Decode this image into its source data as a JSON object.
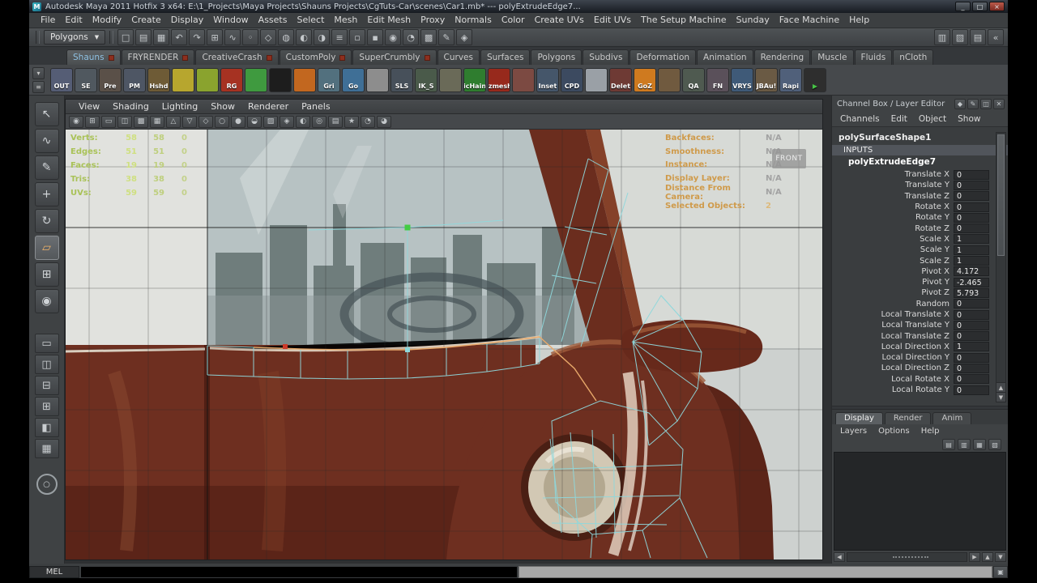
{
  "colors": {
    "accent_active_tab_text": "#8fc1e3",
    "hud_label_green": "#a9c257",
    "hud_value_green": "#cfe080",
    "hud_label_orange": "#cf9a4a",
    "hud_value_gray": "#a2a2a2",
    "car_body": "#6e2f20",
    "wireframe_cyan": "#8fd8dc",
    "selected_edge_orange": "#e8a96a",
    "vertex_green": "#44cc44",
    "vertex_red": "#cc3a2a"
  },
  "title_bar": {
    "title": "Autodesk Maya 2011 Hotfix 3 x64: E:\\1_Projects\\Maya Projects\\Shauns Projects\\CgTuts-Car\\scenes\\Car1.mb*   ---   polyExtrudeEdge7...",
    "logo": "M",
    "minimize": "_",
    "maximize": "□",
    "close": "×"
  },
  "menu_bar": {
    "items": [
      "File",
      "Edit",
      "Modify",
      "Create",
      "Display",
      "Window",
      "Assets",
      "Select",
      "Mesh",
      "Edit Mesh",
      "Proxy",
      "Normals",
      "Color",
      "Create UVs",
      "Edit UVs",
      "The Setup Machine",
      "Sunday",
      "Face Machine",
      "Help"
    ]
  },
  "status_line": {
    "menuset": "Polygons",
    "arrow": "▼",
    "icons": [
      {
        "name": "new-scene-icon",
        "glyph": "□"
      },
      {
        "name": "open-scene-icon",
        "glyph": "▤"
      },
      {
        "name": "save-scene-icon",
        "glyph": "▦"
      },
      {
        "name": "undo-icon",
        "glyph": "↶"
      },
      {
        "name": "redo-icon",
        "glyph": "↷"
      },
      {
        "name": "snap-to-grid-icon",
        "glyph": "⊞"
      },
      {
        "name": "snap-to-curve-icon",
        "glyph": "∿"
      },
      {
        "name": "snap-to-point-icon",
        "glyph": "◦"
      },
      {
        "name": "snap-to-plane-icon",
        "glyph": "◇"
      },
      {
        "name": "make-live-icon",
        "glyph": "◍"
      },
      {
        "name": "input-connections-icon",
        "glyph": "◐"
      },
      {
        "name": "output-connections-icon",
        "glyph": "◑"
      },
      {
        "name": "construction-history-icon",
        "glyph": "≡"
      },
      {
        "name": "select-by-object-icon",
        "glyph": "▫"
      },
      {
        "name": "select-by-component-icon",
        "glyph": "▪"
      },
      {
        "name": "render-current-frame-icon",
        "glyph": "◉"
      },
      {
        "name": "ipr-render-icon",
        "glyph": "◔"
      },
      {
        "name": "render-settings-icon",
        "glyph": "▩"
      },
      {
        "name": "paint-effects-icon",
        "glyph": "✎"
      },
      {
        "name": "hypershade-icon",
        "glyph": "◈"
      }
    ],
    "right_icons": [
      {
        "name": "attribute-editor-toggle-icon",
        "glyph": "▥"
      },
      {
        "name": "tool-settings-toggle-icon",
        "glyph": "▨"
      },
      {
        "name": "channel-box-toggle-icon",
        "glyph": "▤"
      },
      {
        "name": "collapse-statusline-icon",
        "glyph": "«"
      }
    ]
  },
  "shelf": {
    "selector_arrow": "▾",
    "selector_menu": "≡",
    "tabs": [
      {
        "label": "Shauns",
        "active": true,
        "marker": true
      },
      {
        "label": "FRYRENDER",
        "marker": true
      },
      {
        "label": "CreativeCrash",
        "marker": true
      },
      {
        "label": "CustomPoly",
        "marker": true
      },
      {
        "label": "SuperCrumbly",
        "marker": true
      },
      {
        "label": "Curves"
      },
      {
        "label": "Surfaces"
      },
      {
        "label": "Polygons"
      },
      {
        "label": "Subdivs"
      },
      {
        "label": "Deformation"
      },
      {
        "label": "Animation"
      },
      {
        "label": "Rendering"
      },
      {
        "label": "Muscle"
      },
      {
        "label": "Fluids"
      },
      {
        "label": "nCloth"
      }
    ],
    "items": [
      {
        "label": "OUT",
        "color": "#555d75"
      },
      {
        "label": "SE",
        "color": "#50585f"
      },
      {
        "label": "Pre",
        "color": "#5a5048"
      },
      {
        "label": "PM",
        "color": "#4e5664"
      },
      {
        "label": "Hshd",
        "color": "#6e5b36"
      },
      {
        "label": "",
        "color": "#b7a62e"
      },
      {
        "label": "",
        "color": "#8aa32e"
      },
      {
        "label": "RG",
        "color": "#a63222"
      },
      {
        "label": "",
        "color": "#3f9a3f"
      },
      {
        "label": "",
        "color": "#1d1d1d"
      },
      {
        "label": "",
        "color": "#c2671f"
      },
      {
        "label": "Gri",
        "color": "#52707e"
      },
      {
        "label": "Go",
        "color": "#3f6f96"
      },
      {
        "label": "",
        "color": "#8d8d8d"
      },
      {
        "label": "SLS",
        "color": "#47505a"
      },
      {
        "label": "IK_S",
        "color": "#4a5a4a"
      },
      {
        "label": "",
        "color": "#6a6a58"
      },
      {
        "label": "icHain",
        "color": "#2f7d2f"
      },
      {
        "label": "izmesh",
        "color": "#97291c"
      },
      {
        "label": "",
        "color": "#7c4a42"
      },
      {
        "label": "Inset",
        "color": "#45566a"
      },
      {
        "label": "CPD",
        "color": "#3c4a60"
      },
      {
        "label": "",
        "color": "#9aa0a6"
      },
      {
        "label": "Delet",
        "color": "#6e3a34"
      },
      {
        "label": "GoZ",
        "color": "#cf7a1f"
      },
      {
        "label": "",
        "color": "#705a3f"
      },
      {
        "label": "QA",
        "color": "#4f5a50"
      },
      {
        "label": "FN",
        "color": "#5a505a"
      },
      {
        "label": "VRYS",
        "color": "#3f5a78"
      },
      {
        "label": "JBAu!",
        "color": "#6a5a44"
      },
      {
        "label": "Rapi",
        "color": "#50607a"
      },
      {
        "label": "▶",
        "color": "#2e2e2e",
        "fg": "#47c247"
      }
    ]
  },
  "toolbox": {
    "tools": [
      {
        "name": "select-tool",
        "glyph": "↖"
      },
      {
        "name": "lasso-select-tool",
        "glyph": "∿"
      },
      {
        "name": "paint-select-tool",
        "glyph": "✎"
      },
      {
        "name": "move-tool",
        "glyph": "+"
      },
      {
        "name": "rotate-tool",
        "glyph": "↻"
      },
      {
        "name": "scale-tool",
        "glyph": "▱",
        "active": true
      },
      {
        "name": "universal-manipulator-tool",
        "glyph": "⊞"
      },
      {
        "name": "soft-mod-tool",
        "glyph": "◉"
      }
    ],
    "layouts": [
      {
        "name": "layout-single-pane",
        "glyph": "▭"
      },
      {
        "name": "layout-two-panes-side",
        "glyph": "◫"
      },
      {
        "name": "layout-two-panes-stacked",
        "glyph": "⊟"
      },
      {
        "name": "layout-four-panes",
        "glyph": "⊞"
      },
      {
        "name": "layout-outliner-persp",
        "glyph": "◧"
      },
      {
        "name": "layout-hypergraph-persp",
        "glyph": "▦"
      }
    ],
    "xview": "○"
  },
  "viewport": {
    "menus": [
      "View",
      "Shading",
      "Lighting",
      "Show",
      "Renderer",
      "Panels"
    ],
    "toolbar_icons": [
      {
        "name": "camera-select-icon",
        "glyph": "◉"
      },
      {
        "name": "grid-toggle-icon",
        "glyph": "⊞"
      },
      {
        "name": "film-gate-icon",
        "glyph": "▭"
      },
      {
        "name": "resolution-gate-icon",
        "glyph": "◫"
      },
      {
        "name": "gate-mask-icon",
        "glyph": "▩"
      },
      {
        "name": "field-chart-icon",
        "glyph": "▦"
      },
      {
        "name": "safe-action-icon",
        "glyph": "△"
      },
      {
        "name": "safe-title-icon",
        "glyph": "▽"
      },
      {
        "name": "frame-all-icon",
        "glyph": "◇"
      },
      {
        "name": "default-lighting-icon",
        "glyph": "○"
      },
      {
        "name": "all-lights-icon",
        "glyph": "●"
      },
      {
        "name": "shadows-icon",
        "glyph": "◒"
      },
      {
        "name": "textured-mode-icon",
        "glyph": "▨"
      },
      {
        "name": "wireframe-on-shaded-icon",
        "glyph": "◈"
      },
      {
        "name": "xray-icon",
        "glyph": "◐"
      },
      {
        "name": "isolate-select-icon",
        "glyph": "◎"
      },
      {
        "name": "image-plane-icon",
        "glyph": "▤"
      },
      {
        "name": "bookmark-icon",
        "glyph": "★"
      },
      {
        "name": "exposure-icon",
        "glyph": "◔"
      },
      {
        "name": "gamma-icon",
        "glyph": "◕"
      }
    ],
    "hud_left": {
      "rows": [
        {
          "label": "Verts:",
          "a": "58",
          "b": "58",
          "c": "0"
        },
        {
          "label": "Edges:",
          "a": "51",
          "b": "51",
          "c": "0"
        },
        {
          "label": "Faces:",
          "a": "19",
          "b": "19",
          "c": "0"
        },
        {
          "label": "Tris:",
          "a": "38",
          "b": "38",
          "c": "0"
        },
        {
          "label": "UVs:",
          "a": "59",
          "b": "59",
          "c": "0"
        }
      ]
    },
    "hud_right": {
      "rows": [
        {
          "label": "Backfaces:",
          "value": "N/A"
        },
        {
          "label": "Smoothness:",
          "value": "N/A"
        },
        {
          "label": "Instance:",
          "value": "N/A"
        },
        {
          "label": "Display Layer:",
          "value": "N/A"
        },
        {
          "label": "Distance From Camera:",
          "value": "N/A"
        },
        {
          "label": "Selected Objects:",
          "value": "2",
          "highlight": true
        }
      ]
    },
    "view_label": "FRONT"
  },
  "channel_box": {
    "header": "Channel Box / Layer Editor",
    "header_icons": [
      {
        "name": "pick-pin-icon",
        "glyph": "◆"
      },
      {
        "name": "edit-channels-icon",
        "glyph": "✎"
      },
      {
        "name": "dock-panel-icon",
        "glyph": "◫"
      },
      {
        "name": "close-panel-icon",
        "glyph": "✕"
      }
    ],
    "menus": [
      "Channels",
      "Edit",
      "Object",
      "Show"
    ],
    "node": "polySurfaceShape1",
    "section": "INPUTS",
    "input_node": "polyExtrudeEdge7",
    "scroll_up": "▲",
    "scroll_down": "▼",
    "attributes": [
      {
        "name": "Translate X",
        "value": "0"
      },
      {
        "name": "Translate Y",
        "value": "0"
      },
      {
        "name": "Translate Z",
        "value": "0"
      },
      {
        "name": "Rotate X",
        "value": "0"
      },
      {
        "name": "Rotate Y",
        "value": "0"
      },
      {
        "name": "Rotate Z",
        "value": "0"
      },
      {
        "name": "Scale X",
        "value": "1"
      },
      {
        "name": "Scale Y",
        "value": "1"
      },
      {
        "name": "Scale Z",
        "value": "1"
      },
      {
        "name": "Pivot X",
        "value": "4.172"
      },
      {
        "name": "Pivot Y",
        "value": "-2.465"
      },
      {
        "name": "Pivot Z",
        "value": "5.793"
      },
      {
        "name": "Random",
        "value": "0"
      },
      {
        "name": "Local Translate X",
        "value": "0"
      },
      {
        "name": "Local Translate Y",
        "value": "0"
      },
      {
        "name": "Local Translate Z",
        "value": "0"
      },
      {
        "name": "Local Direction X",
        "value": "1"
      },
      {
        "name": "Local Direction Y",
        "value": "0"
      },
      {
        "name": "Local Direction Z",
        "value": "0"
      },
      {
        "name": "Local Rotate X",
        "value": "0"
      },
      {
        "name": "Local Rotate Y",
        "value": "0"
      }
    ]
  },
  "layer_editor": {
    "tabs": [
      {
        "label": "Display",
        "active": true
      },
      {
        "label": "Render"
      },
      {
        "label": "Anim"
      }
    ],
    "menus": [
      "Layers",
      "Options",
      "Help"
    ],
    "toolbar_icons": [
      {
        "name": "move-layer-icon",
        "glyph": "▤"
      },
      {
        "name": "empty-layer-icon",
        "glyph": "▥"
      },
      {
        "name": "new-layer-icon",
        "glyph": "▦"
      },
      {
        "name": "new-layer-from-selected-icon",
        "glyph": "▧"
      }
    ],
    "hscroll": {
      "left": "◀",
      "right": "▶",
      "up": "▲",
      "down": "▼"
    }
  },
  "command_line": {
    "label": "MEL",
    "script_editor_icon": "▣"
  }
}
